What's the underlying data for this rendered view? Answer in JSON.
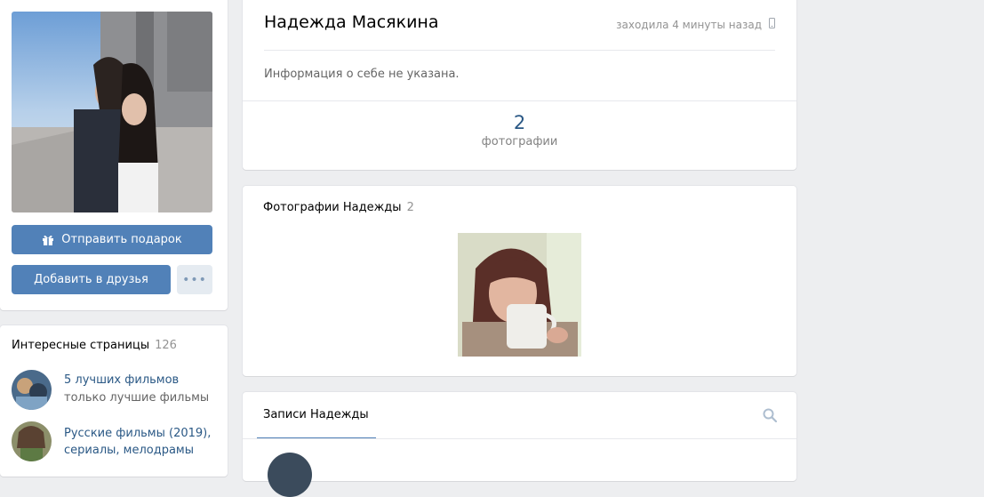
{
  "profile": {
    "name": "Надежда Масякина",
    "last_seen": "заходила 4 минуты назад",
    "about": "Информация о себе не указана.",
    "photos_count": "2",
    "photos_label": "фотографии"
  },
  "actions": {
    "gift_label": "Отправить подарок",
    "add_friend_label": "Добавить в друзья",
    "more_label": "•••"
  },
  "interesting": {
    "title": "Интересные страницы",
    "count": "126",
    "items": [
      {
        "name": "5 лучших фильмов",
        "subtitle": "только лучшие фильмы"
      },
      {
        "name": "Русские фильмы (2019), сериалы, мелодрамы"
      }
    ]
  },
  "photos_block": {
    "title": "Фотографии Надежды",
    "count": "2"
  },
  "wall": {
    "tab_label": "Записи Надежды"
  },
  "colors": {
    "accent": "#5181b8",
    "link": "#2a5885",
    "background": "#edeef0"
  },
  "icons": [
    "gift-icon",
    "phone-icon",
    "search-icon",
    "more-icon"
  ]
}
